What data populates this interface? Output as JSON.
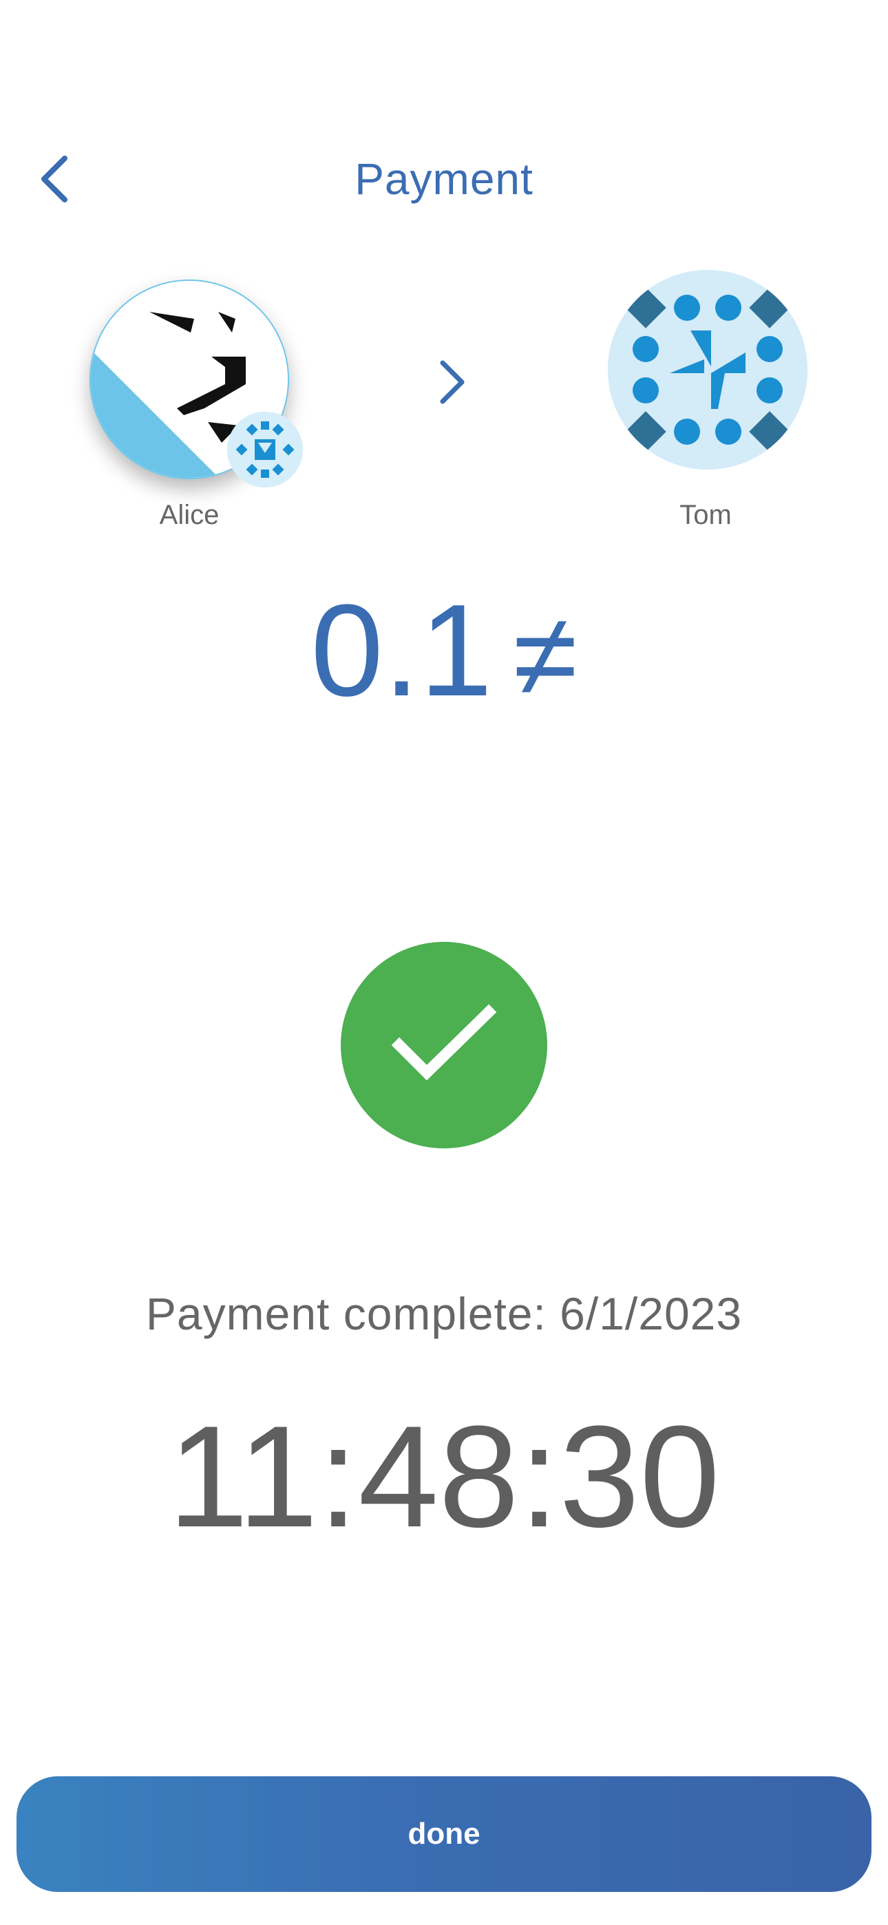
{
  "header": {
    "title": "Payment"
  },
  "transfer": {
    "from": {
      "name": "Alice"
    },
    "to": {
      "name": "Tom"
    }
  },
  "amount": {
    "value": "0.1",
    "currency_symbol": "≠"
  },
  "status": {
    "text": "Payment complete: 6/1/2023",
    "time": "11:48:30"
  },
  "actions": {
    "done_label": "done"
  },
  "colors": {
    "accent": "#3b6db2",
    "success": "#4caf50",
    "text_muted": "#666666"
  },
  "icons": {
    "back": "chevron-left-icon",
    "transfer_arrow": "chevron-right-icon",
    "success": "checkmark-icon"
  }
}
